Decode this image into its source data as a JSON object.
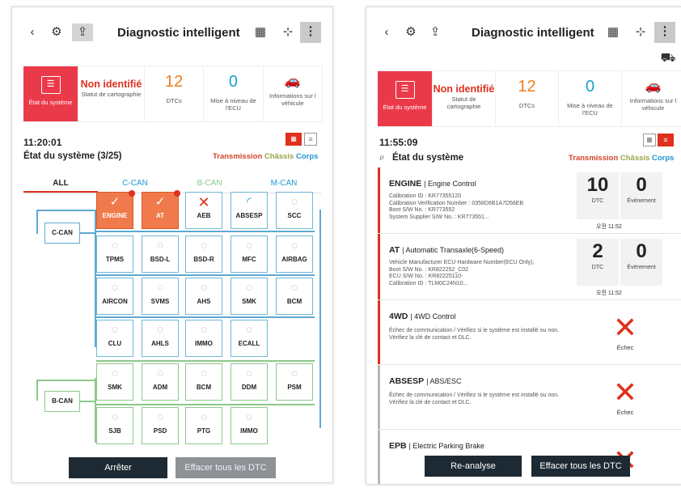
{
  "left": {
    "title": "Diagnostic intelligent",
    "cards": {
      "system_label": "État du système",
      "mapping_value": "Non identifié",
      "mapping_label": "Statut de cartographie",
      "dtc_value": "12",
      "dtc_label": "DTCs",
      "update_value": "0",
      "update_label": "Mise à niveau de l'ECU",
      "vehicle_label": "Informations sur l véhicule"
    },
    "time": "11:20:01",
    "status": "État du système (3/25)",
    "cats": {
      "t": "Transmission",
      "c": "Châssis",
      "b": "Corps"
    },
    "tabs": [
      "ALL",
      "C-CAN",
      "B-CAN",
      "M-CAN"
    ],
    "buses": [
      "C-CAN",
      "B-CAN"
    ],
    "ecus": [
      {
        "name": "ENGINE",
        "state": "error"
      },
      {
        "name": "AT",
        "state": "error"
      },
      {
        "name": "AEB",
        "state": "fail"
      },
      {
        "name": "ABSESP",
        "state": "loading"
      },
      {
        "name": "SCC",
        "state": "ok"
      },
      {
        "name": "TPMS",
        "state": "ok"
      },
      {
        "name": "BSD-L",
        "state": "ok"
      },
      {
        "name": "BSD-R",
        "state": "ok"
      },
      {
        "name": "MFC",
        "state": "ok"
      },
      {
        "name": "AIRBAG",
        "state": "ok"
      },
      {
        "name": "AIRCON",
        "state": "ok"
      },
      {
        "name": "SVMS",
        "state": "ok"
      },
      {
        "name": "AHS",
        "state": "ok"
      },
      {
        "name": "SMK",
        "state": "ok"
      },
      {
        "name": "BCM",
        "state": "ok"
      },
      {
        "name": "CLU",
        "state": "ok"
      },
      {
        "name": "AHLS",
        "state": "ok"
      },
      {
        "name": "IMMO",
        "state": "ok"
      },
      {
        "name": "ECALL",
        "state": "ok"
      },
      {
        "name": "SMK",
        "state": "ok"
      },
      {
        "name": "ADM",
        "state": "ok"
      },
      {
        "name": "BCM",
        "state": "ok"
      },
      {
        "name": "DDM",
        "state": "ok"
      },
      {
        "name": "PSM",
        "state": "ok"
      },
      {
        "name": "SJB",
        "state": "ok"
      },
      {
        "name": "PSD",
        "state": "ok"
      },
      {
        "name": "PTG",
        "state": "ok"
      },
      {
        "name": "IMMO",
        "state": "ok"
      }
    ],
    "btn_stop": "Arrêter",
    "btn_clear": "Effacer tous les DTC"
  },
  "right": {
    "title": "Diagnostic intelligent",
    "cards": {
      "system_label": "État du système",
      "mapping_value": "Non identifié",
      "mapping_label": "Statut de cartographie",
      "dtc_value": "12",
      "dtc_label": "DTCs",
      "update_value": "0",
      "update_label": "Mise à niveau de l'ECU",
      "vehicle_label": "Informations sur l véhicule"
    },
    "time": "11:55:09",
    "status": "État du système",
    "cats": {
      "t": "Transmission",
      "c": "Châssis",
      "b": "Corps"
    },
    "rows": [
      {
        "title": "ENGINE",
        "subtitle": "| Engine Control",
        "details": [
          "Calibration ID : KR77355120",
          "Calibration Verification Number : 0358D6B1A7D56EB",
          "Boot S/W No. : KR773552",
          "System Supplier S/W No. : KR773551..."
        ],
        "dtc": "10",
        "dtc_label": "DTC",
        "event": "0",
        "event_label": "Événement",
        "stamp": "오전 11:52"
      },
      {
        "title": "AT",
        "subtitle": "| Automatic Transaxle(6-Speed)",
        "details": [
          "Vehicle Manufacturer ECU Hardware Number(ECU Only);",
          "Boot S/W No. : KR822252_C02",
          "ECU S/W No. : KR82225110-",
          "Calibration ID : TLM0C24N10..."
        ],
        "dtc": "2",
        "dtc_label": "DTC",
        "event": "0",
        "event_label": "Événement",
        "stamp": "오전 11:52"
      },
      {
        "title": "4WD",
        "subtitle": "| 4WD Control",
        "details": [
          "Échec de communication / Vérifiez si le système est installé ou non. Vérifiez la clé de contact et DLC."
        ],
        "fail_label": "Échec"
      },
      {
        "title": "ABSESP",
        "subtitle": "| ABS/ESC",
        "details": [
          "Échec de communication / Vérifiez si le système est installé ou non. Vérifiez la clé de contact et DLC."
        ],
        "fail_label": "Échec"
      },
      {
        "title": "EPB",
        "subtitle": "| Electric Parking Brake"
      }
    ],
    "btn_rescan": "Re-analyse",
    "btn_clear": "Effacer tous les DTC"
  }
}
